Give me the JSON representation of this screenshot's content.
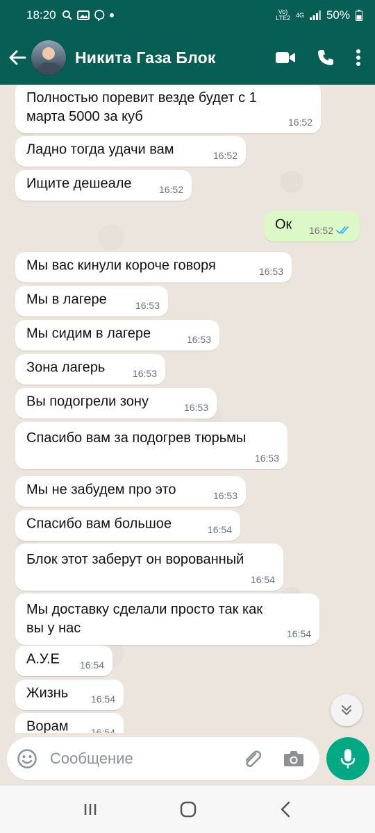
{
  "status_bar": {
    "time": "18:20",
    "network_top": "Vo)",
    "network_bottom": "LTE2",
    "signal_type": "4G",
    "battery": "50%"
  },
  "header": {
    "contact_name": "Никита Газа Блок"
  },
  "messages": [
    {
      "dir": "in",
      "text": "Полностью поревит везде будет с 1\nмарта 5000 за куб",
      "time": "16:52"
    },
    {
      "dir": "in",
      "text": "Ладно тогда удачи вам",
      "time": "16:52"
    },
    {
      "dir": "in",
      "text": "Ищите дешеале",
      "time": "16:52"
    },
    {
      "dir": "out",
      "text": "Ок",
      "time": "16:52",
      "read": true
    },
    {
      "dir": "in",
      "text": "Мы вас кинули короче говоря",
      "time": "16:53"
    },
    {
      "dir": "in",
      "text": "Мы в лагере",
      "time": "16:53"
    },
    {
      "dir": "in",
      "text": "Мы сидим в лагере",
      "time": "16:53"
    },
    {
      "dir": "in",
      "text": "Зона лагерь",
      "time": "16:53"
    },
    {
      "dir": "in",
      "text": "Вы подогрели зону",
      "time": "16:53"
    },
    {
      "dir": "in",
      "text": "Спасибо вам за подогрев тюрьмы",
      "time": "16:53"
    },
    {
      "dir": "in",
      "text": "Мы не забудем про это",
      "time": "16:53"
    },
    {
      "dir": "in",
      "text": "Спасибо вам большое",
      "time": "16:54"
    },
    {
      "dir": "in",
      "text": "Блок этот заберут он ворованный",
      "time": "16:54"
    },
    {
      "dir": "in",
      "text": "Мы доставку сделали просто так как\nвы у нас",
      "time": "16:54"
    },
    {
      "dir": "in",
      "text": "А.У.Е",
      "time": "16:54"
    },
    {
      "dir": "in",
      "text": "Жизнь",
      "time": "16:54"
    },
    {
      "dir": "in",
      "text": "Ворам",
      "time": "16:54"
    }
  ],
  "composer": {
    "placeholder": "Сообщение"
  },
  "colors": {
    "header": "#075e54",
    "incoming_bubble": "#ffffff",
    "outgoing_bubble": "#dcf8c6",
    "read_ticks": "#34b7f1",
    "mic_button": "#00a884",
    "chat_background": "#ece5dd"
  },
  "icons": {
    "back": "arrow-left-icon",
    "video": "video-camera-icon",
    "call": "phone-icon",
    "menu": "more-vertical-icon",
    "emoji": "emoji-icon",
    "attach": "paperclip-icon",
    "camera": "camera-icon",
    "mic": "microphone-icon",
    "scroll": "double-chevron-down-icon"
  }
}
